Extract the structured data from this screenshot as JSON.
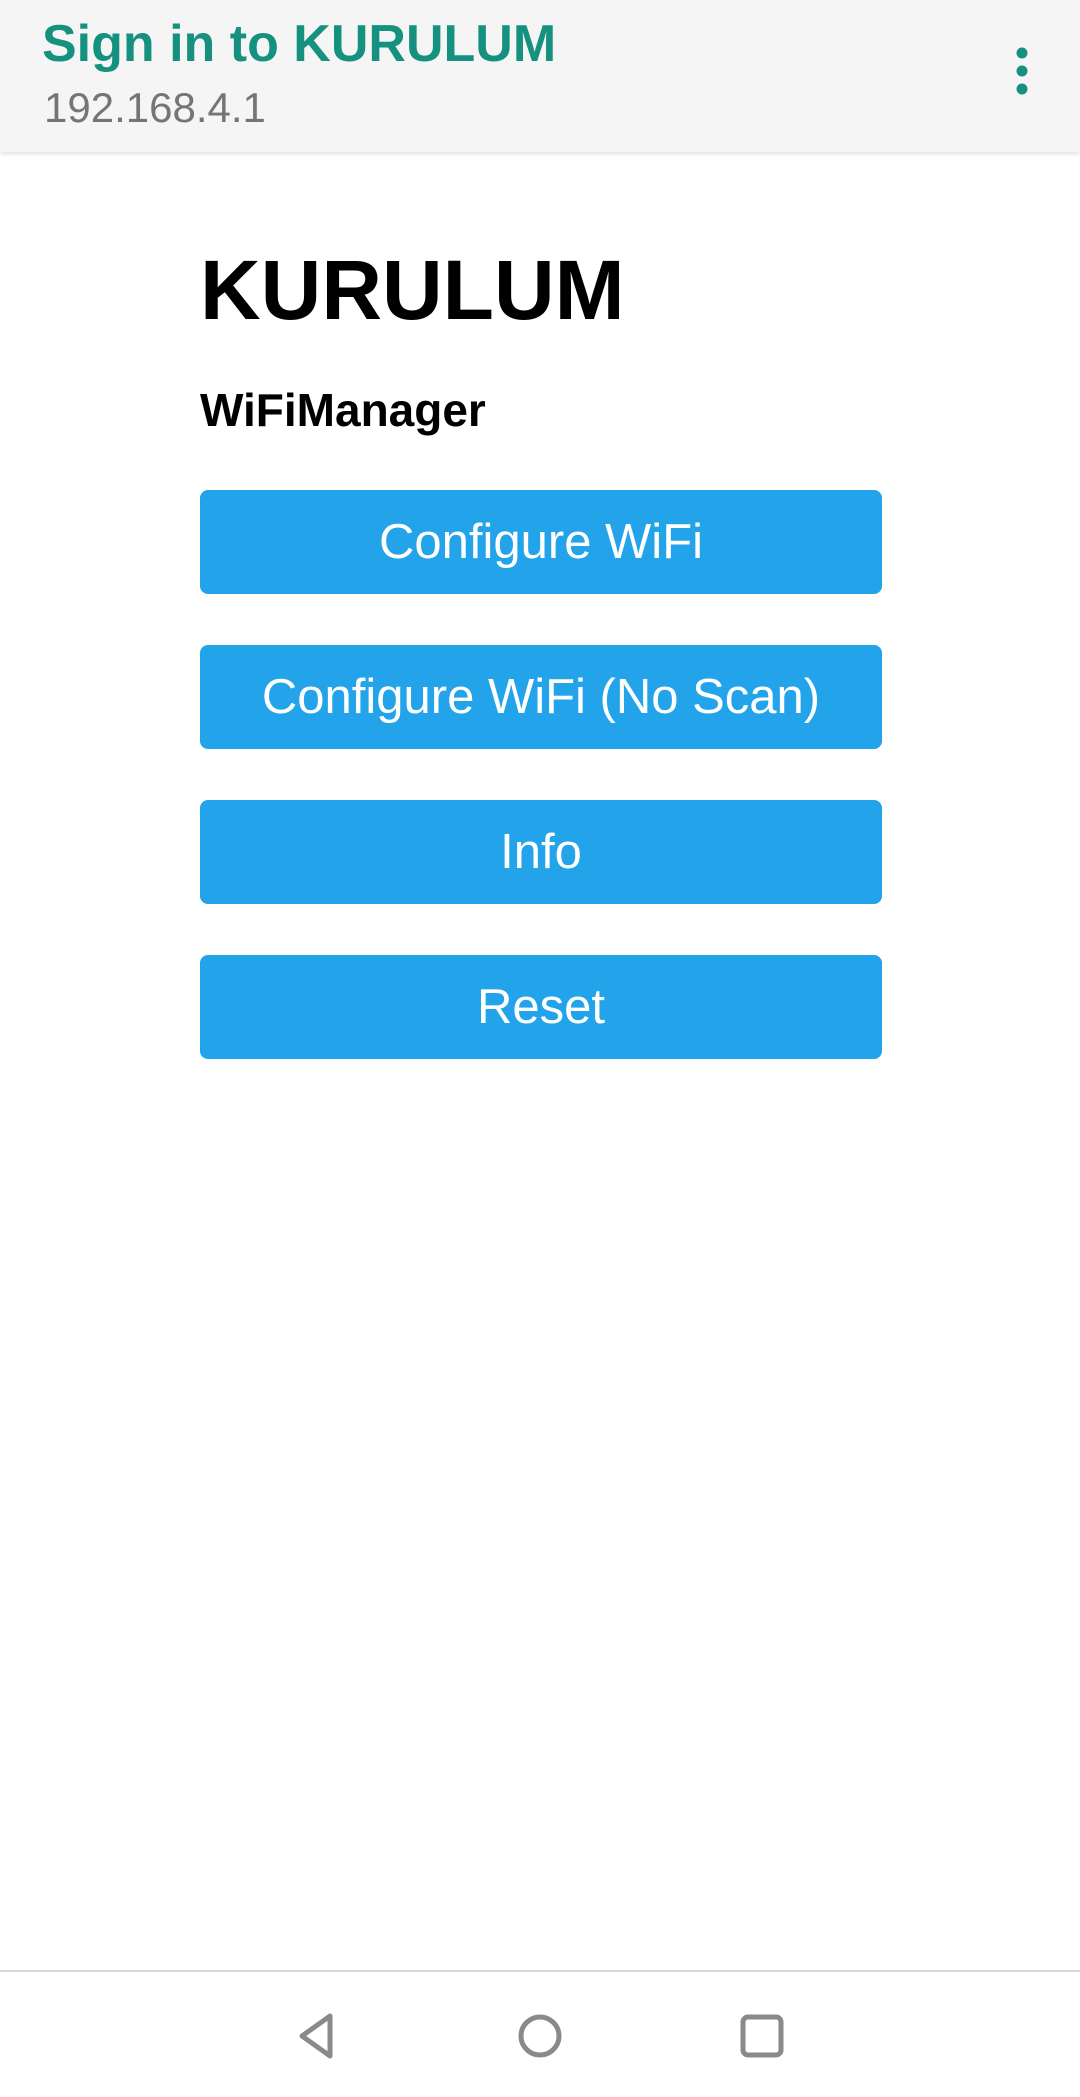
{
  "topbar": {
    "title": "Sign in to KURULUM",
    "subtitle": "192.168.4.1",
    "menu_icon": "more-vert-icon"
  },
  "main": {
    "heading": "KURULUM",
    "subheading": "WiFiManager",
    "buttons": [
      {
        "label": "Configure WiFi"
      },
      {
        "label": "Configure WiFi (No Scan)"
      },
      {
        "label": "Info"
      },
      {
        "label": "Reset"
      }
    ]
  },
  "navbar": {
    "back_icon": "back-triangle-icon",
    "home_icon": "home-circle-icon",
    "recents_icon": "recents-square-icon"
  },
  "colors": {
    "title": "#16917f",
    "subtitle": "#757575",
    "button_bg": "#22a3ea",
    "button_text": "#ffffff",
    "topbar_bg": "#f5f5f5"
  }
}
